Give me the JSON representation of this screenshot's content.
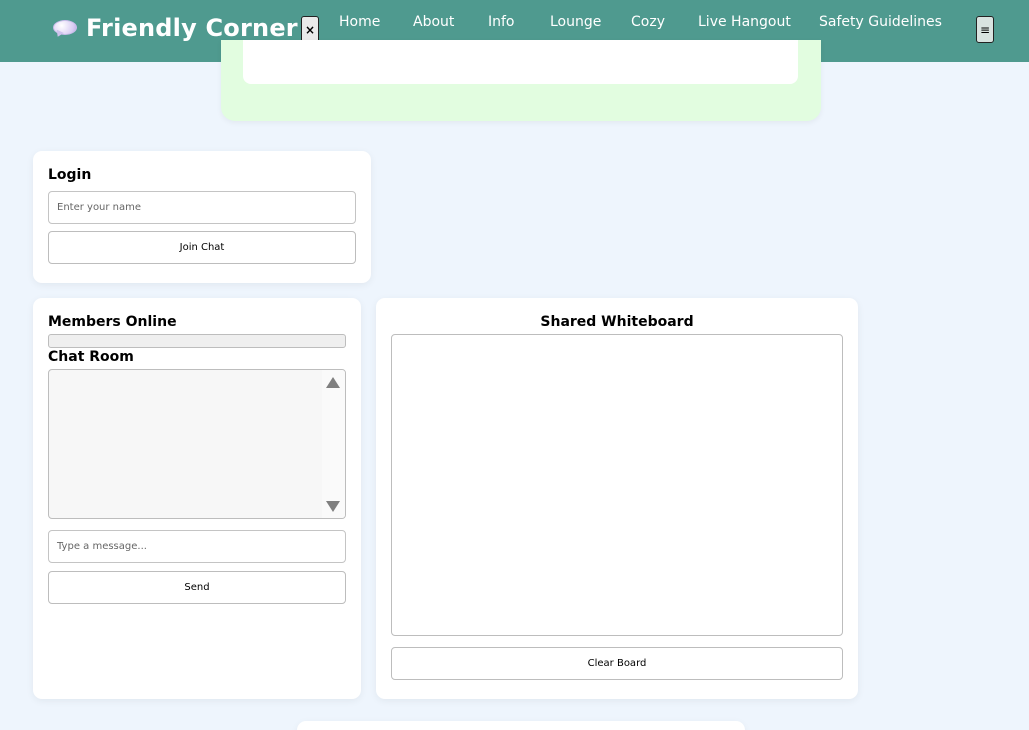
{
  "header": {
    "brand": "Friendly Corner",
    "close_label": "×",
    "menu_label": "≡",
    "nav": [
      "Home",
      "About",
      "Info",
      "Lounge",
      "Cozy",
      "Live Hangout",
      "Safety Guidelines"
    ]
  },
  "login": {
    "title": "Login",
    "name_placeholder": "Enter your name",
    "join_label": "Join Chat"
  },
  "chat": {
    "members_title": "Members Online",
    "room_title": "Chat Room",
    "message_placeholder": "Type a message...",
    "send_label": "Send"
  },
  "whiteboard": {
    "title": "Shared Whiteboard",
    "clear_label": "Clear Board"
  },
  "colors": {
    "header_bg": "#4f9a8f",
    "page_bg": "#eef5fd",
    "panel_green": "#e2fde0"
  }
}
